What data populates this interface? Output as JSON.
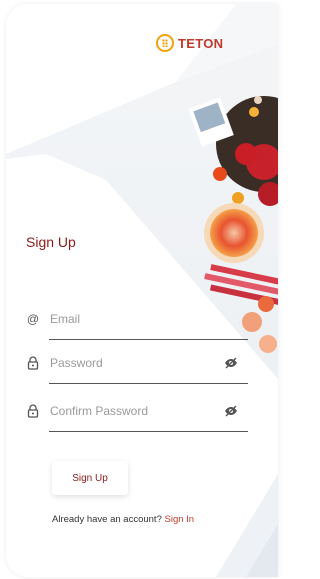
{
  "brand": {
    "name": "TETON"
  },
  "page": {
    "title": "Sign Up"
  },
  "form": {
    "email": {
      "placeholder": "Email",
      "icon": "at-icon"
    },
    "password": {
      "placeholder": "Password",
      "icon": "lock-icon"
    },
    "confirm_password": {
      "placeholder": "Confirm Password",
      "icon": "lock-icon"
    }
  },
  "actions": {
    "submit_label": "Sign Up",
    "footer_text": "Already have an account? ",
    "signin_link": "Sign In"
  },
  "colors": {
    "accent": "#8b1a1a",
    "logo": "#c0392b",
    "logo_mark": "#f2a20b"
  }
}
